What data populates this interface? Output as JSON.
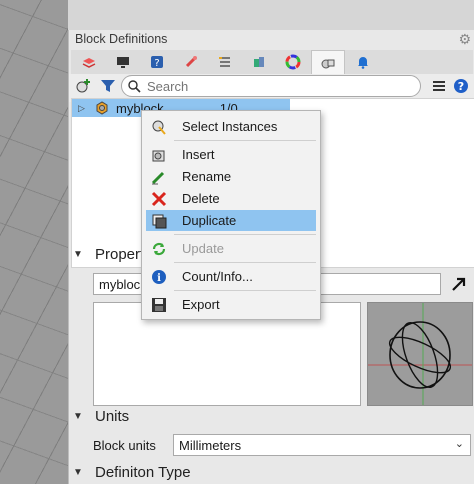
{
  "panel": {
    "title": "Block Definitions"
  },
  "tabs": [
    {
      "icon": "layers-icon"
    },
    {
      "icon": "display-icon"
    },
    {
      "icon": "help-icon"
    },
    {
      "icon": "material-icon"
    },
    {
      "icon": "layout-icon"
    },
    {
      "icon": "render-icon"
    },
    {
      "icon": "color-wheel-icon"
    },
    {
      "icon": "block-definitions-icon",
      "active": true
    },
    {
      "icon": "notifications-icon"
    }
  ],
  "search": {
    "placeholder": "Search"
  },
  "tree": {
    "items": [
      {
        "name": "myblock",
        "count": "1/0",
        "selected": true
      }
    ]
  },
  "context_menu": {
    "items": [
      {
        "label": "Select Instances",
        "icon": "select-instances-icon"
      },
      {
        "label": "Insert",
        "icon": "insert-icon"
      },
      {
        "label": "Rename",
        "icon": "rename-icon"
      },
      {
        "label": "Delete",
        "icon": "delete-icon"
      },
      {
        "label": "Duplicate",
        "icon": "duplicate-icon",
        "highlighted": true
      },
      {
        "label": "Update",
        "icon": "update-icon",
        "disabled": true
      },
      {
        "label": "Count/Info...",
        "icon": "info-icon"
      },
      {
        "label": "Export",
        "icon": "export-icon"
      }
    ]
  },
  "properties": {
    "header": "Properties",
    "name_value": "myblock",
    "description_value": ""
  },
  "units": {
    "header": "Units",
    "label": "Block units",
    "value": "Millimeters"
  },
  "definition_type": {
    "header": "Definiton Type"
  },
  "colors": {
    "selection": "#8fc4f0",
    "delete_red": "#d9251d",
    "info_blue": "#1e5fbf"
  }
}
